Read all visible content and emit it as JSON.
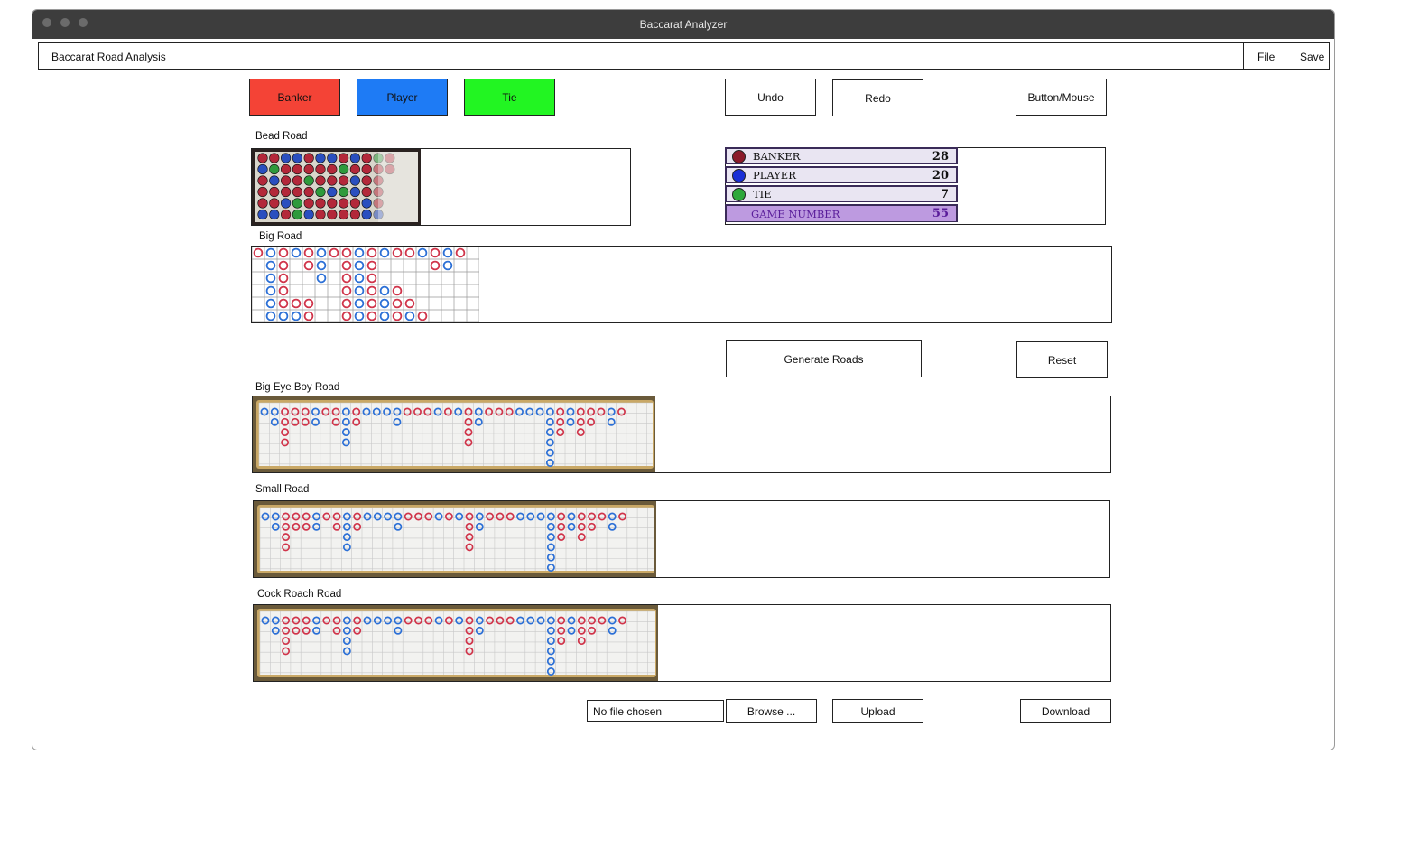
{
  "window": {
    "title": "Baccarat Analyzer"
  },
  "menu": {
    "app_title": "Baccarat Road Analysis",
    "file": "File",
    "save": "Save"
  },
  "outcome_buttons": {
    "banker": "Banker",
    "player": "Player",
    "tie": "Tie"
  },
  "toolbar": {
    "undo": "Undo",
    "redo": "Redo",
    "button_mouse": "Button/Mouse"
  },
  "labels": {
    "bead_road": "Bead Road",
    "big_road": "Big Road",
    "big_eye_boy_road": "Big Eye Boy Road",
    "small_road": "Small Road",
    "cock_roach_road": "Cock Roach Road"
  },
  "stats": {
    "banker": {
      "label": "BANKER",
      "value": "28"
    },
    "player": {
      "label": "PLAYER",
      "value": "20"
    },
    "tie": {
      "label": "TIE",
      "value": "7"
    },
    "game_number": {
      "label": "GAME NUMBER",
      "value": "55"
    }
  },
  "actions": {
    "generate": "Generate Roads",
    "reset": "Reset"
  },
  "file": {
    "input_text": "No file chosen",
    "browse": "Browse ...",
    "upload": "Upload",
    "download": "Download"
  },
  "colors": {
    "banker": "#f44336",
    "player": "#1e7bf5",
    "tie": "#22f522",
    "banker_dot": "#8b1a2a",
    "player_dot": "#1a2fd6",
    "tie_dot": "#2ea83a",
    "road_red": "#d0344a",
    "road_blue": "#2b6fd6"
  },
  "icons": {
    "window_controls": [
      "close-dot",
      "minimize-dot",
      "maximize-dot"
    ]
  }
}
